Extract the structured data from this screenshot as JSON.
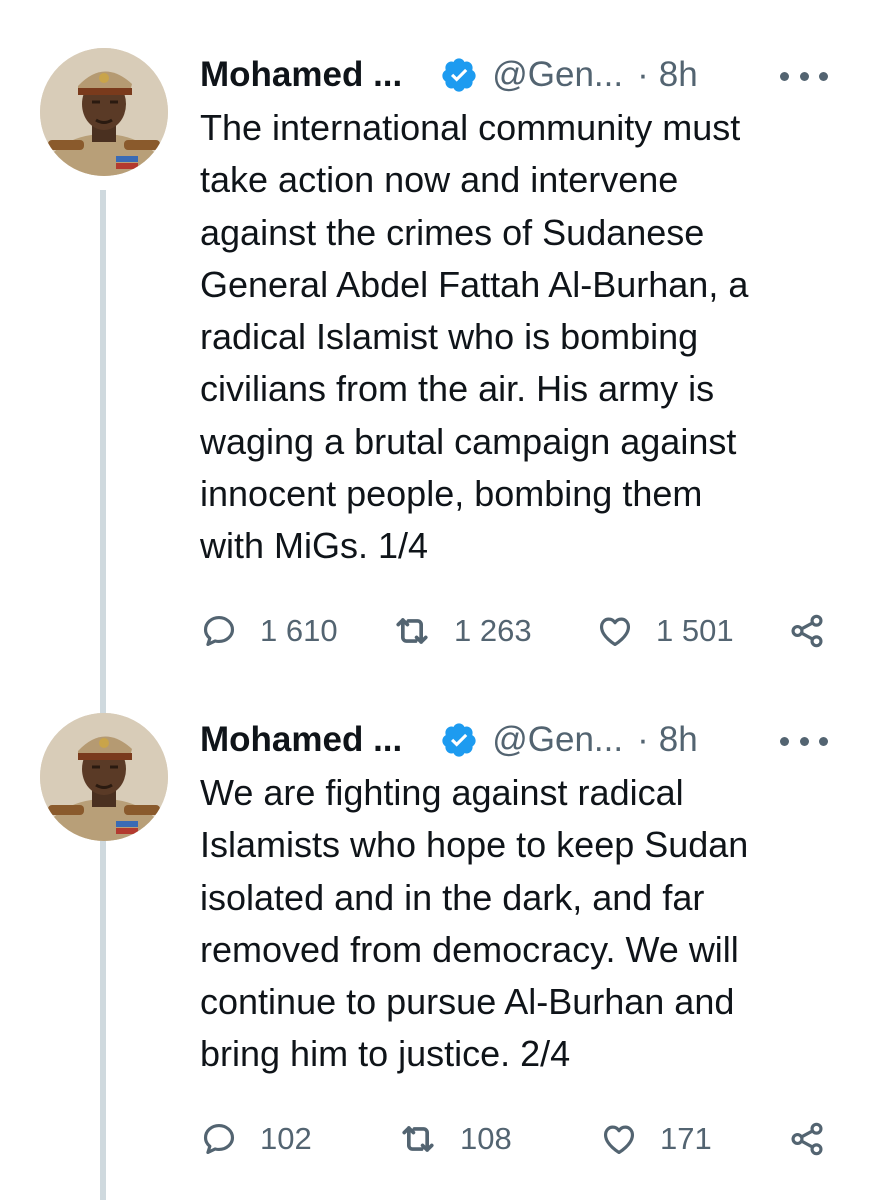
{
  "tweets": [
    {
      "author_name": "Mohamed ...",
      "handle": "@Gen...",
      "separator": "·",
      "time": "8h",
      "body_lines": [
        "The international community must",
        "take action now and intervene",
        "against the crimes of Sudanese",
        "General Abdel Fattah Al-Burhan, a",
        "radical Islamist who is bombing",
        "civilians from the air. His army is",
        "waging a brutal campaign against",
        "innocent people, bombing them",
        "with MiGs. 1/4"
      ],
      "replies": "1 610",
      "retweets": "1 263",
      "likes": "1 501"
    },
    {
      "author_name": "Mohamed ...",
      "handle": "@Gen...",
      "separator": "·",
      "time": "8h",
      "body_lines": [
        "We are fighting against radical",
        "Islamists who hope to keep Sudan",
        "isolated and in the dark, and far",
        "removed from democracy. We will",
        "continue to pursue Al-Burhan and",
        "bring him to justice. 2/4"
      ],
      "replies": "102",
      "retweets": "108",
      "likes": "171"
    }
  ],
  "icons": {
    "verified": "verified-badge-icon",
    "more": "more-horizontal-icon",
    "reply": "reply-icon",
    "retweet": "retweet-icon",
    "like": "heart-icon",
    "share": "share-icon"
  },
  "colors": {
    "text": "#0f1419",
    "secondary": "#536471",
    "verified": "#1d9bf0",
    "thread_line": "#cfd9de"
  }
}
